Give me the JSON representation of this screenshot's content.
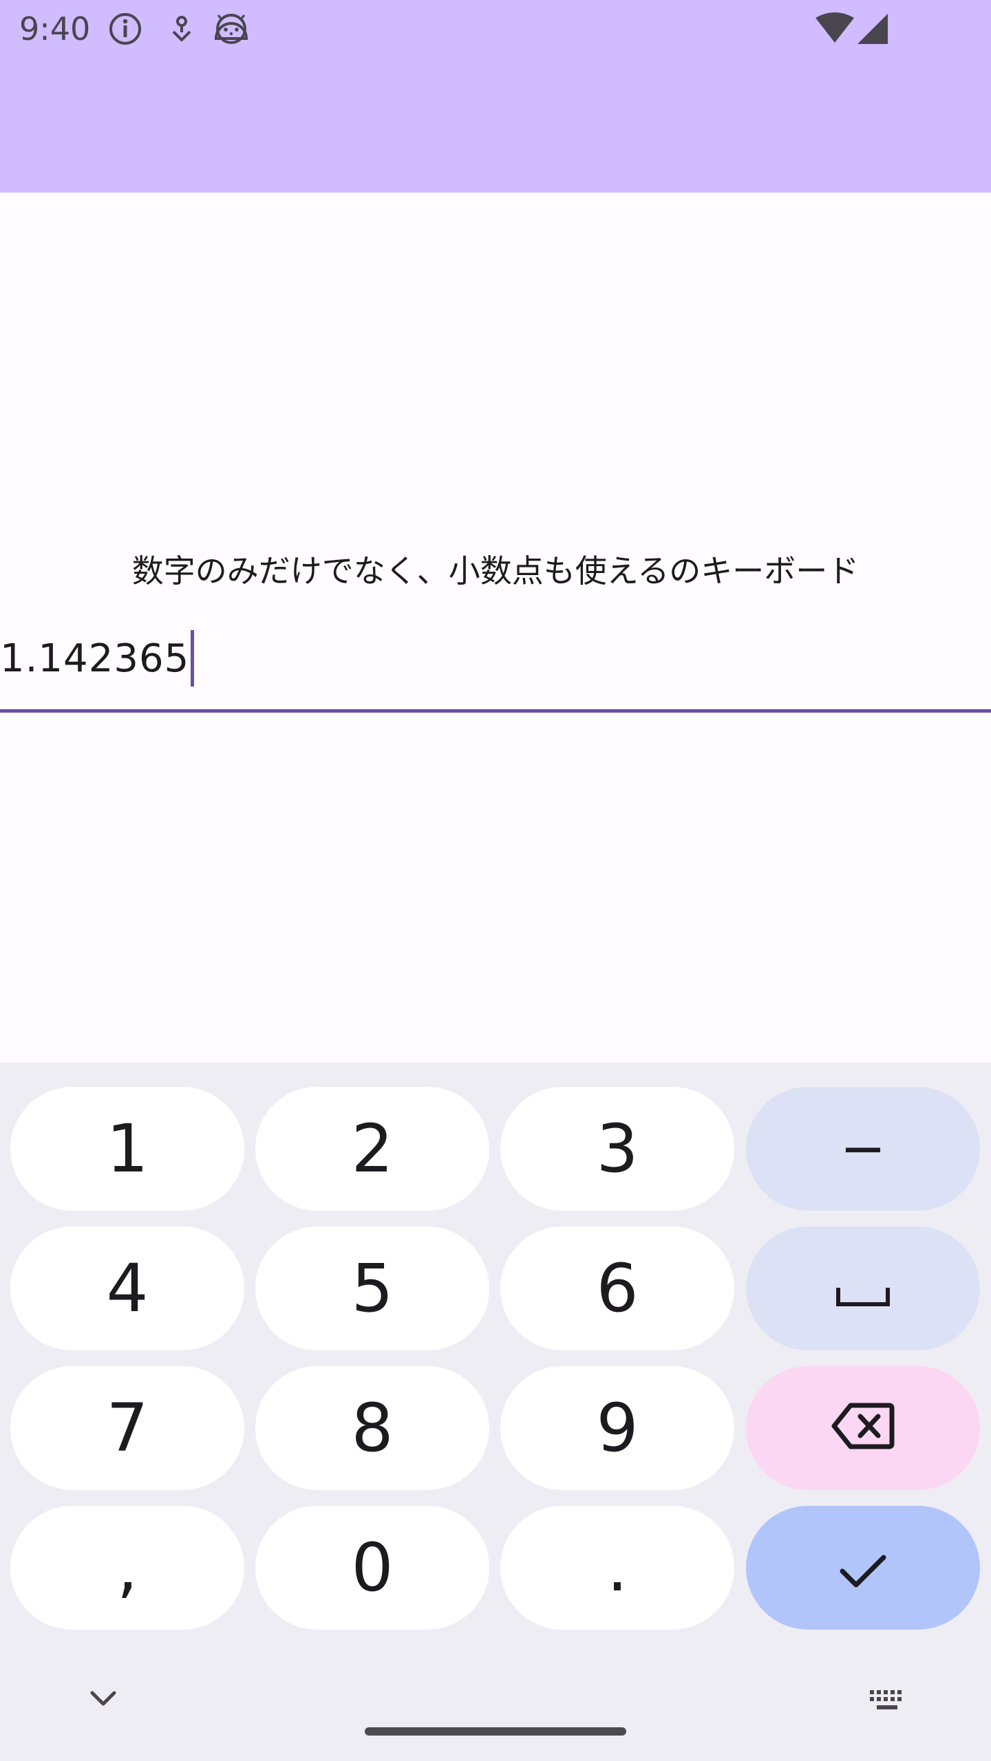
{
  "status_bar": {
    "time": "9:40",
    "background": "#d0bcff",
    "left_icons": [
      "info-icon",
      "tethering-icon",
      "android-head-icon"
    ],
    "right_icons": [
      "wifi-icon",
      "cell-signal-icon"
    ]
  },
  "main": {
    "label": "数字のみだけでなく、小数点も使えるのキーボード",
    "input": {
      "value": "1.142365",
      "accent": "#6750a4"
    }
  },
  "keyboard": {
    "rows": [
      [
        {
          "label": "1"
        },
        {
          "label": "2"
        },
        {
          "label": "3"
        },
        {
          "label": "−"
        }
      ],
      [
        {
          "label": "4"
        },
        {
          "label": "5"
        },
        {
          "label": "6"
        },
        {
          "icon": "space-icon"
        }
      ],
      [
        {
          "label": "7"
        },
        {
          "label": "8"
        },
        {
          "label": "9"
        },
        {
          "icon": "backspace-icon"
        }
      ],
      [
        {
          "label": ","
        },
        {
          "label": "0"
        },
        {
          "label": "."
        },
        {
          "icon": "check-icon"
        }
      ]
    ],
    "colors": {
      "background": "#efedf4",
      "key": "#ffffff",
      "function_key": "#dde1f5",
      "delete_key": "#fbd7f3",
      "enter_key": "#b1c5fb"
    },
    "bottom_icons": [
      "chevron-down-icon",
      "keyboard-icon"
    ]
  }
}
